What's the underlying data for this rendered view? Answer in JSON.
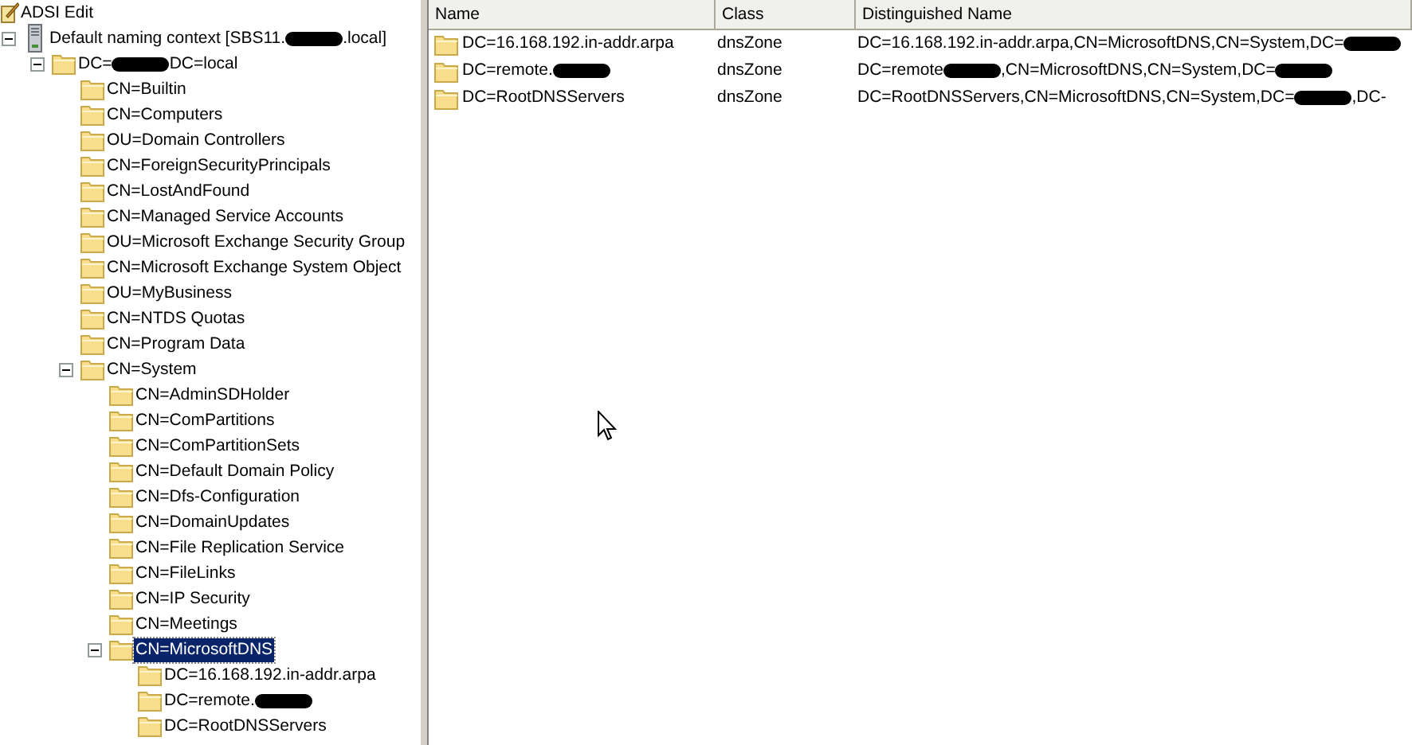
{
  "tree": {
    "title": "ADSI Edit",
    "nodes": [
      {
        "segments": [
          {
            "kind": "text",
            "text": "Default naming context [SBS11."
          },
          {
            "kind": "redaction"
          },
          {
            "kind": "text",
            "text": ".local]"
          }
        ],
        "expanded": true,
        "selected": false,
        "children": [
          {
            "segments": [
              {
                "kind": "text",
                "text": "DC="
              },
              {
                "kind": "redaction"
              },
              {
                "kind": "text",
                "text": "DC=local"
              }
            ],
            "expanded": true,
            "selected": false,
            "children": [
              {
                "segments": [
                  {
                    "kind": "text",
                    "text": "CN=Builtin"
                  }
                ],
                "selected": false
              },
              {
                "segments": [
                  {
                    "kind": "text",
                    "text": "CN=Computers"
                  }
                ],
                "selected": false
              },
              {
                "segments": [
                  {
                    "kind": "text",
                    "text": "OU=Domain Controllers"
                  }
                ],
                "selected": false
              },
              {
                "segments": [
                  {
                    "kind": "text",
                    "text": "CN=ForeignSecurityPrincipals"
                  }
                ],
                "selected": false
              },
              {
                "segments": [
                  {
                    "kind": "text",
                    "text": "CN=LostAndFound"
                  }
                ],
                "selected": false
              },
              {
                "segments": [
                  {
                    "kind": "text",
                    "text": "CN=Managed Service Accounts"
                  }
                ],
                "selected": false
              },
              {
                "segments": [
                  {
                    "kind": "text",
                    "text": "OU=Microsoft Exchange Security Group"
                  }
                ],
                "selected": false
              },
              {
                "segments": [
                  {
                    "kind": "text",
                    "text": "CN=Microsoft Exchange System Object"
                  }
                ],
                "selected": false
              },
              {
                "segments": [
                  {
                    "kind": "text",
                    "text": "OU=MyBusiness"
                  }
                ],
                "selected": false
              },
              {
                "segments": [
                  {
                    "kind": "text",
                    "text": "CN=NTDS Quotas"
                  }
                ],
                "selected": false
              },
              {
                "segments": [
                  {
                    "kind": "text",
                    "text": "CN=Program Data"
                  }
                ],
                "selected": false
              },
              {
                "segments": [
                  {
                    "kind": "text",
                    "text": "CN=System"
                  }
                ],
                "expanded": true,
                "selected": false,
                "children": [
                  {
                    "segments": [
                      {
                        "kind": "text",
                        "text": "CN=AdminSDHolder"
                      }
                    ],
                    "selected": false
                  },
                  {
                    "segments": [
                      {
                        "kind": "text",
                        "text": "CN=ComPartitions"
                      }
                    ],
                    "selected": false
                  },
                  {
                    "segments": [
                      {
                        "kind": "text",
                        "text": "CN=ComPartitionSets"
                      }
                    ],
                    "selected": false
                  },
                  {
                    "segments": [
                      {
                        "kind": "text",
                        "text": "CN=Default Domain Policy"
                      }
                    ],
                    "selected": false
                  },
                  {
                    "segments": [
                      {
                        "kind": "text",
                        "text": "CN=Dfs-Configuration"
                      }
                    ],
                    "selected": false
                  },
                  {
                    "segments": [
                      {
                        "kind": "text",
                        "text": "CN=DomainUpdates"
                      }
                    ],
                    "selected": false
                  },
                  {
                    "segments": [
                      {
                        "kind": "text",
                        "text": "CN=File Replication Service"
                      }
                    ],
                    "selected": false
                  },
                  {
                    "segments": [
                      {
                        "kind": "text",
                        "text": "CN=FileLinks"
                      }
                    ],
                    "selected": false
                  },
                  {
                    "segments": [
                      {
                        "kind": "text",
                        "text": "CN=IP Security"
                      }
                    ],
                    "selected": false
                  },
                  {
                    "segments": [
                      {
                        "kind": "text",
                        "text": "CN=Meetings"
                      }
                    ],
                    "selected": false
                  },
                  {
                    "segments": [
                      {
                        "kind": "text",
                        "text": "CN=MicrosoftDNS"
                      }
                    ],
                    "expanded": true,
                    "selected": true,
                    "children": [
                      {
                        "segments": [
                          {
                            "kind": "text",
                            "text": "DC=16.168.192.in-addr.arpa"
                          }
                        ],
                        "selected": false
                      },
                      {
                        "segments": [
                          {
                            "kind": "text",
                            "text": "DC=remote."
                          },
                          {
                            "kind": "redaction"
                          }
                        ],
                        "selected": false
                      },
                      {
                        "segments": [
                          {
                            "kind": "text",
                            "text": "DC=RootDNSServers"
                          }
                        ],
                        "selected": false
                      }
                    ]
                  }
                ]
              }
            ]
          }
        ]
      }
    ]
  },
  "list": {
    "columns": [
      "Name",
      "Class",
      "Distinguished Name"
    ],
    "rows": [
      {
        "name": [
          {
            "kind": "text",
            "text": "DC=16.168.192.in-addr.arpa"
          }
        ],
        "class": "dnsZone",
        "dn": [
          {
            "kind": "text",
            "text": "DC=16.168.192.in-addr.arpa,CN=MicrosoftDNS,CN=System,DC="
          },
          {
            "kind": "redaction"
          }
        ]
      },
      {
        "name": [
          {
            "kind": "text",
            "text": "DC=remote."
          },
          {
            "kind": "redaction"
          }
        ],
        "class": "dnsZone",
        "dn": [
          {
            "kind": "text",
            "text": "DC=remote"
          },
          {
            "kind": "redaction"
          },
          {
            "kind": "text",
            "text": ",CN=MicrosoftDNS,CN=System,DC="
          },
          {
            "kind": "redaction"
          }
        ]
      },
      {
        "name": [
          {
            "kind": "text",
            "text": "DC=RootDNSServers"
          }
        ],
        "class": "dnsZone",
        "dn": [
          {
            "kind": "text",
            "text": "DC=RootDNSServers,CN=MicrosoftDNS,CN=System,DC="
          },
          {
            "kind": "redaction"
          },
          {
            "kind": "text",
            "text": ",DC-"
          }
        ]
      }
    ]
  }
}
